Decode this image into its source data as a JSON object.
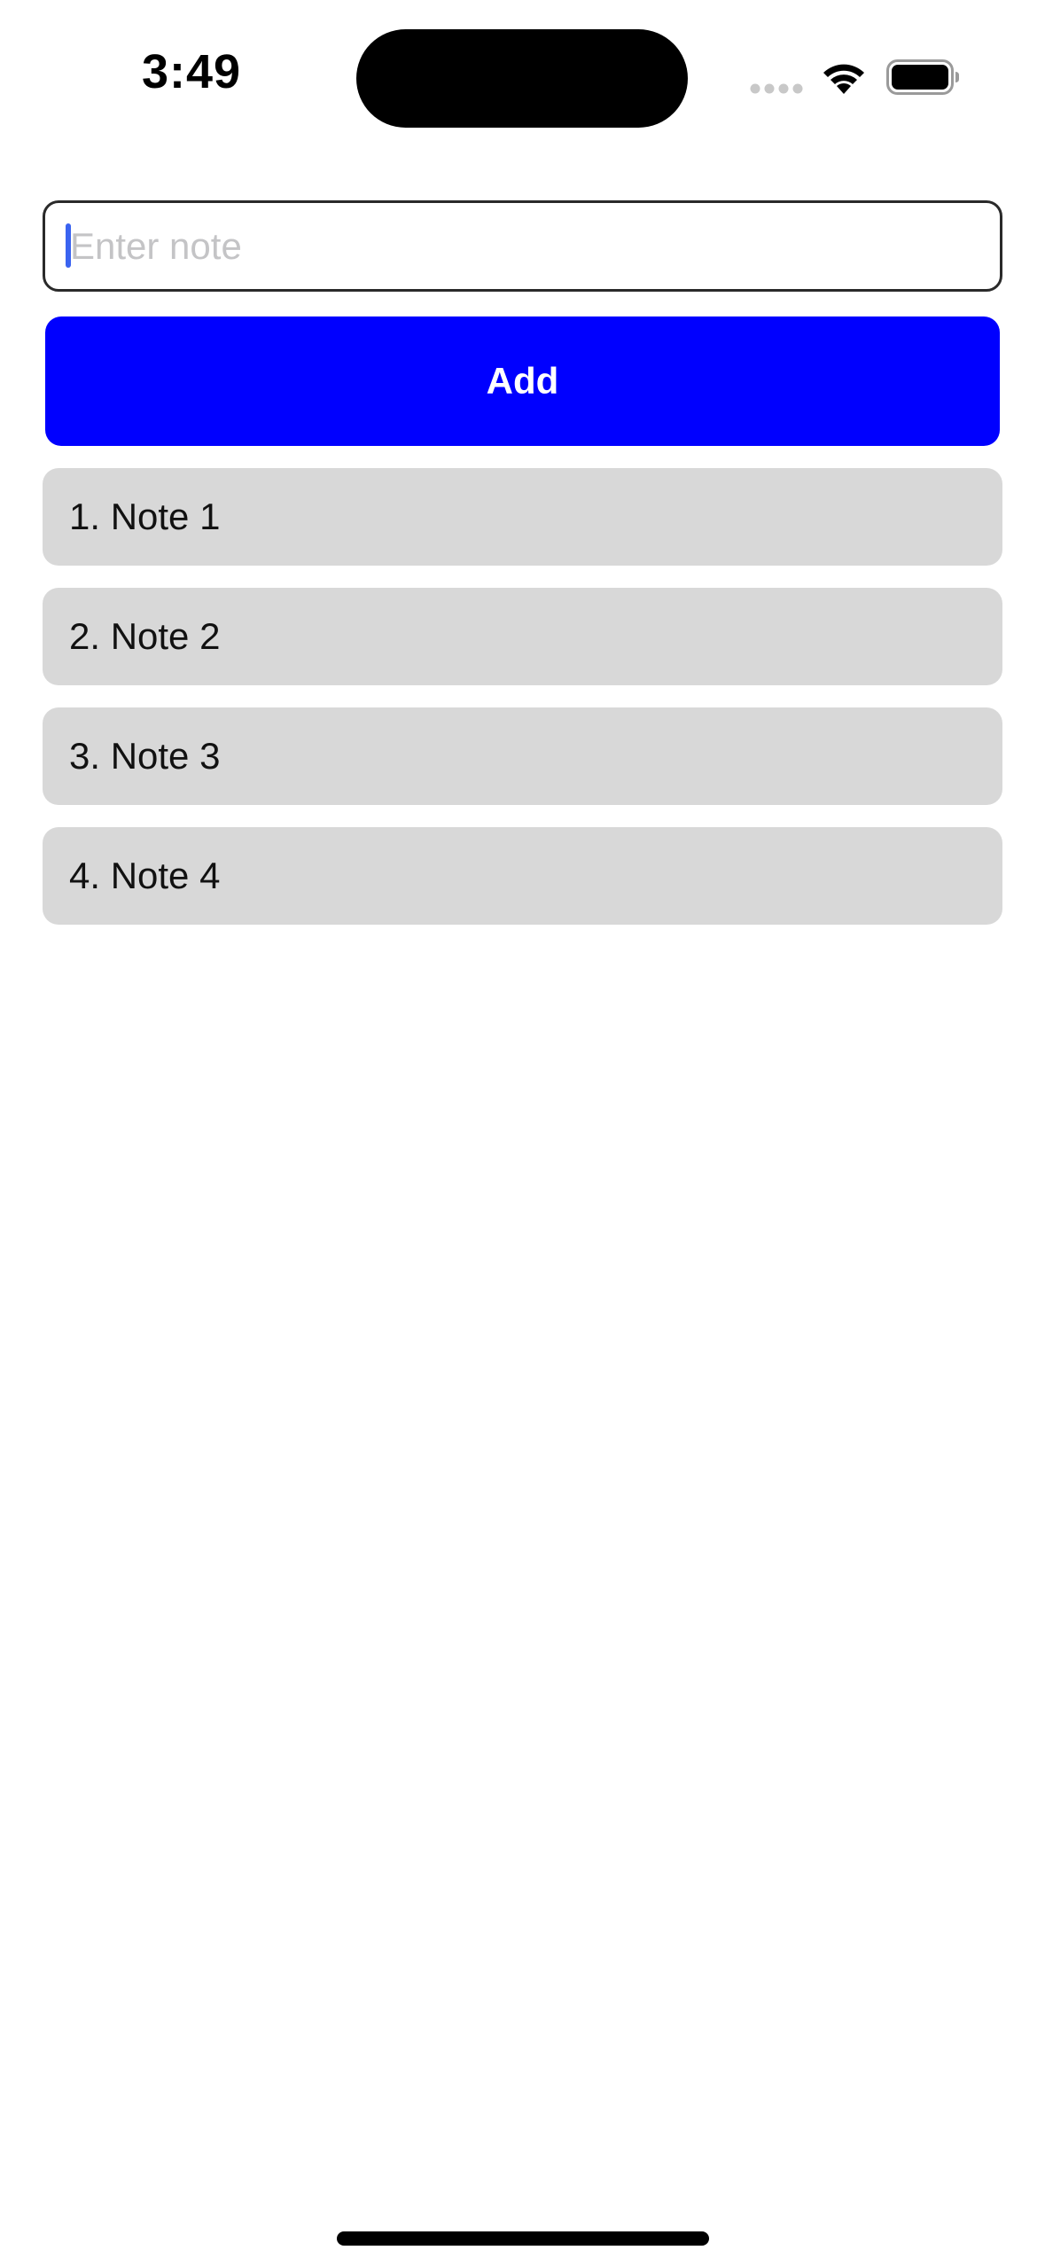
{
  "status_bar": {
    "time": "3:49",
    "icons": [
      "signal-dots-icon",
      "wifi-icon",
      "battery-icon"
    ]
  },
  "note_input": {
    "value": "",
    "placeholder": "Enter note"
  },
  "add_button": {
    "label": "Add",
    "color": "#0000ff"
  },
  "notes": [
    {
      "label": "1. Note 1"
    },
    {
      "label": "2. Note 2"
    },
    {
      "label": "3. Note 3"
    },
    {
      "label": "4. Note 4"
    }
  ]
}
